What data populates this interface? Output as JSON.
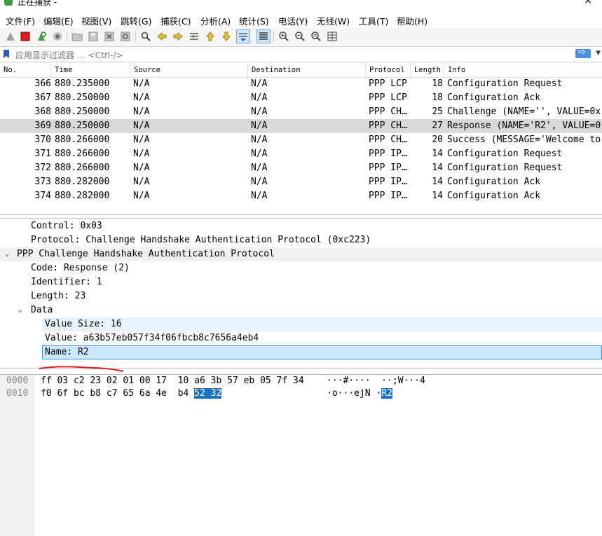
{
  "window": {
    "title": "正在捕获 -",
    "close": "×"
  },
  "menu": [
    "文件(F)",
    "编辑(E)",
    "视图(V)",
    "跳转(G)",
    "捕获(C)",
    "分析(A)",
    "统计(S)",
    "电话(Y)",
    "无线(W)",
    "工具(T)",
    "帮助(H)"
  ],
  "toolbar_icons": [
    "shark-fin-start-icon",
    "stop-capture-icon",
    "restart-capture-icon",
    "capture-options-icon",
    "open-file-icon",
    "save-file-icon",
    "close-file-icon",
    "reload-file-icon",
    "find-packet-icon",
    "go-back-icon",
    "go-forward-icon",
    "go-to-packet-icon",
    "go-first-icon",
    "go-last-icon",
    "autoscroll-icon",
    "colorize-icon",
    "zoom-in-icon",
    "zoom-out-icon",
    "zoom-normal-icon",
    "resize-columns-icon"
  ],
  "filter": {
    "placeholder": "应用显示过滤器 … <Ctrl-/>",
    "apply": "⇨"
  },
  "packet_list": {
    "columns": [
      "No.",
      "Time",
      "Source",
      "Destination",
      "Protocol",
      "Length",
      "Info"
    ],
    "rows": [
      {
        "no": "366",
        "time": "880.235000",
        "src": "N/A",
        "dst": "N/A",
        "proto": "PPP LCP",
        "len": "18",
        "info": "Configuration Request"
      },
      {
        "no": "367",
        "time": "880.250000",
        "src": "N/A",
        "dst": "N/A",
        "proto": "PPP LCP",
        "len": "18",
        "info": "Configuration Ack"
      },
      {
        "no": "368",
        "time": "880.250000",
        "src": "N/A",
        "dst": "N/A",
        "proto": "PPP CH…",
        "len": "25",
        "info": "Challenge (NAME='', VALUE=0x"
      },
      {
        "no": "369",
        "time": "880.250000",
        "src": "N/A",
        "dst": "N/A",
        "proto": "PPP CH…",
        "len": "27",
        "info": "Response (NAME='R2', VALUE=0"
      },
      {
        "no": "370",
        "time": "880.266000",
        "src": "N/A",
        "dst": "N/A",
        "proto": "PPP CH…",
        "len": "20",
        "info": "Success (MESSAGE='Welcome to"
      },
      {
        "no": "371",
        "time": "880.266000",
        "src": "N/A",
        "dst": "N/A",
        "proto": "PPP IP…",
        "len": "14",
        "info": "Configuration Request"
      },
      {
        "no": "372",
        "time": "880.266000",
        "src": "N/A",
        "dst": "N/A",
        "proto": "PPP IP…",
        "len": "14",
        "info": "Configuration Request"
      },
      {
        "no": "373",
        "time": "880.282000",
        "src": "N/A",
        "dst": "N/A",
        "proto": "PPP IP…",
        "len": "14",
        "info": "Configuration Ack"
      },
      {
        "no": "374",
        "time": "880.282000",
        "src": "N/A",
        "dst": "N/A",
        "proto": "PPP IP…",
        "len": "14",
        "info": "Configuration Ack"
      }
    ],
    "selected_no": "369"
  },
  "details": {
    "control": "Control: 0x03",
    "protocol": "Protocol: Challenge Handshake Authentication Protocol (0xc223)",
    "chap_header": "PPP Challenge Handshake Authentication Protocol",
    "code": "Code: Response (2)",
    "identifier": "Identifier: 1",
    "length": "Length: 23",
    "data_header": "Data",
    "value_size": "Value Size: 16",
    "value": "Value: a63b57eb057f34f06fbcb8c7656a4eb4",
    "name": "Name: R2",
    "expand_glyph": "⌄"
  },
  "hex": {
    "lines": [
      {
        "offset": "0000",
        "bytes_a": "ff 03 c2 23 02 01 00 17  10 a6 3b 57 eb 05 7f 34",
        "bytes_sel": "",
        "ascii_a": "···#····  ··;W···4",
        "ascii_sel": ""
      },
      {
        "offset": "0010",
        "bytes_a": "f0 6f bc b8 c7 65 6a 4e  b4 ",
        "bytes_sel": "52 32",
        "ascii_a": "·o···ejN ·",
        "ascii_sel": "R2"
      }
    ]
  },
  "colors": {
    "selection": "#1a72c7",
    "row_selected": "#d9d9d9",
    "annotation": "#e02020"
  }
}
